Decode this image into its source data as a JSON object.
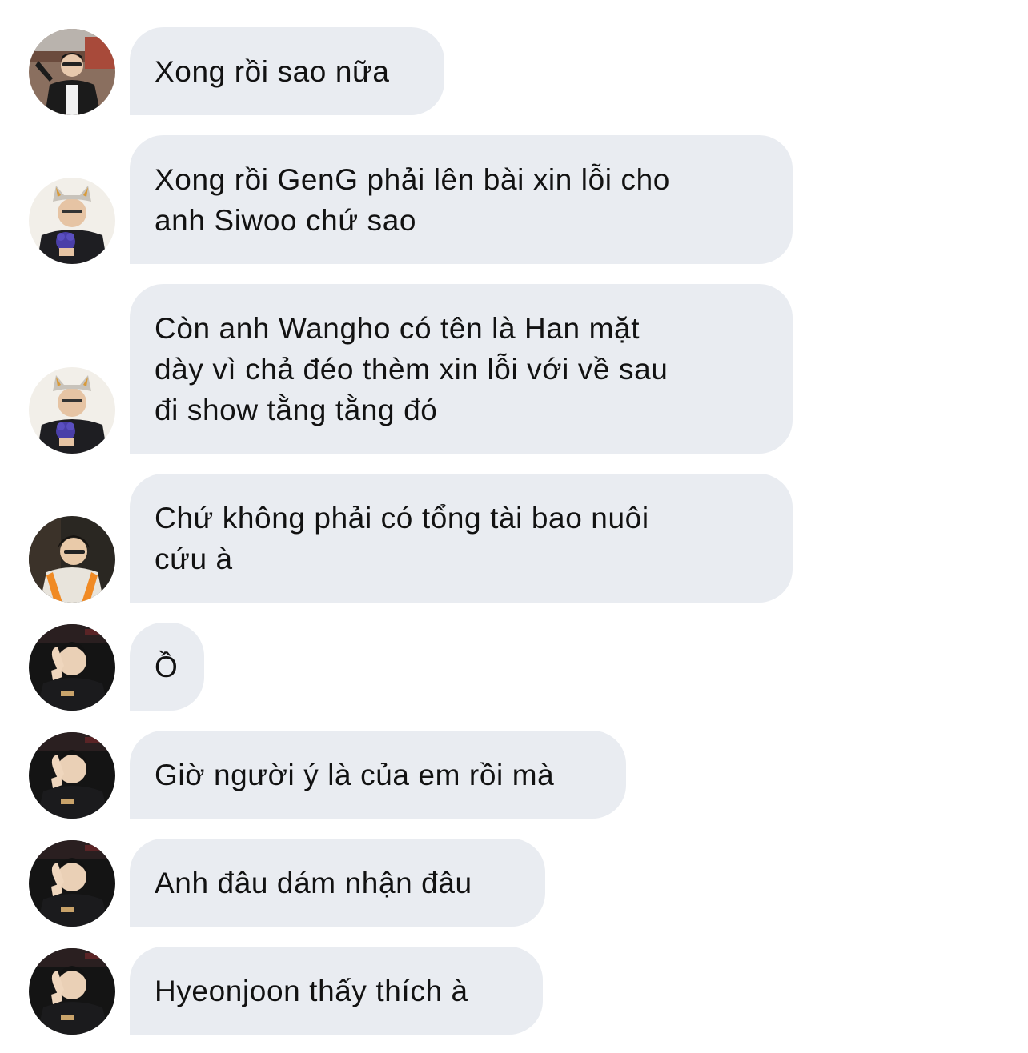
{
  "messages": [
    {
      "text": "Xong rồi sao nữa",
      "avatar": "avatar-jacket-outdoor"
    },
    {
      "text": "Xong rồi GenG phải lên bài xin lỗi cho\nanh Siwoo chứ sao",
      "avatar": "avatar-cat-hat"
    },
    {
      "text": "Còn anh Wangho có tên là Han mặt\ndày vì chả đéo thèm xin lỗi với về sau\nđi show tằng tằng đó",
      "avatar": "avatar-cat-hat"
    },
    {
      "text": "Chứ không phải có tổng tài bao nuôi\ncứu à",
      "avatar": "avatar-orange-jersey"
    },
    {
      "text": "Ồ",
      "avatar": "avatar-hand-on-face"
    },
    {
      "text": "Giờ người ý là của em rồi mà",
      "avatar": "avatar-hand-on-face"
    },
    {
      "text": "Anh đâu dám nhận đâu",
      "avatar": "avatar-hand-on-face"
    },
    {
      "text": "Hyeonjoon thấy thích à",
      "avatar": "avatar-hand-on-face"
    }
  ],
  "colors": {
    "bubble": "#e9ecf1",
    "text": "#121212",
    "background": "#ffffff"
  }
}
